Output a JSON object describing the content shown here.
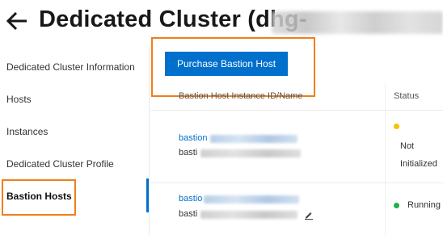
{
  "header": {
    "title": "Dedicated Cluster (dhg-"
  },
  "sidebar": {
    "items": [
      {
        "label": "Dedicated Cluster Information"
      },
      {
        "label": "Hosts"
      },
      {
        "label": "Instances"
      },
      {
        "label": "Dedicated Cluster Profile"
      },
      {
        "label": "Bastion Hosts",
        "active": true
      }
    ]
  },
  "toolbar": {
    "purchase_label": "Purchase Bastion Host"
  },
  "table": {
    "columns": [
      "Bastion Host Instance ID/Name",
      "Status"
    ],
    "rows": [
      {
        "id_prefix": "bastion",
        "name_prefix": "basti",
        "status": [
          "Not",
          "Initialized"
        ],
        "status_color": "#f5c400"
      },
      {
        "id_prefix": "bastio",
        "name_prefix": "basti",
        "status": [
          "Running"
        ],
        "status_color": "#22b04a"
      }
    ]
  },
  "colors": {
    "accent": "#0070cc",
    "highlight": "#ef7f1a"
  }
}
